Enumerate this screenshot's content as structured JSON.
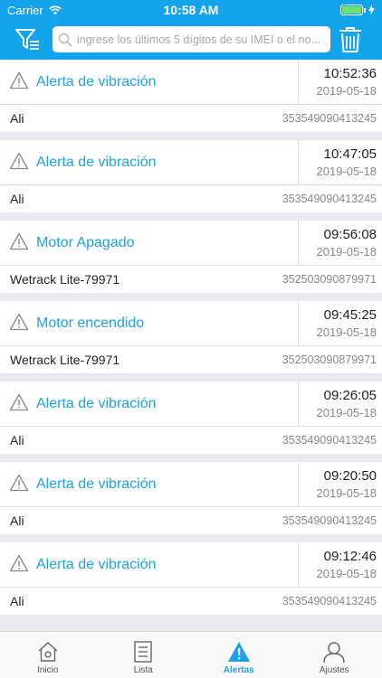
{
  "status_bar": {
    "carrier": "Carrier",
    "time": "10:58 AM"
  },
  "search": {
    "placeholder": "ingrese los últimos 5 dígitos de su IMEI o el no..."
  },
  "alerts": [
    {
      "title": "Alerta de vibración",
      "time": "10:52:36",
      "date": "2019-05-18",
      "device": "Ali",
      "imei": "353549090413245"
    },
    {
      "title": "Alerta de vibración",
      "time": "10:47:05",
      "date": "2019-05-18",
      "device": "Ali",
      "imei": "353549090413245"
    },
    {
      "title": "Motor Apagado",
      "time": "09:56:08",
      "date": "2019-05-18",
      "device": "Wetrack Lite-79971",
      "imei": "352503090879971"
    },
    {
      "title": "Motor encendido",
      "time": "09:45:25",
      "date": "2019-05-18",
      "device": "Wetrack Lite-79971",
      "imei": "352503090879971"
    },
    {
      "title": "Alerta de vibración",
      "time": "09:26:05",
      "date": "2019-05-18",
      "device": "Ali",
      "imei": "353549090413245"
    },
    {
      "title": "Alerta de vibración",
      "time": "09:20:50",
      "date": "2019-05-18",
      "device": "Ali",
      "imei": "353549090413245"
    },
    {
      "title": "Alerta de vibración",
      "time": "09:12:46",
      "date": "2019-05-18",
      "device": "Ali",
      "imei": "353549090413245"
    }
  ],
  "tabs": [
    {
      "label": "Inicio",
      "icon": "home-icon"
    },
    {
      "label": "Lista",
      "icon": "list-icon"
    },
    {
      "label": "Alertas",
      "icon": "alert-icon"
    },
    {
      "label": "Ajustes",
      "icon": "user-icon"
    }
  ],
  "colors": {
    "accent": "#14a4ec",
    "alert_title": "#1aa3e8"
  }
}
